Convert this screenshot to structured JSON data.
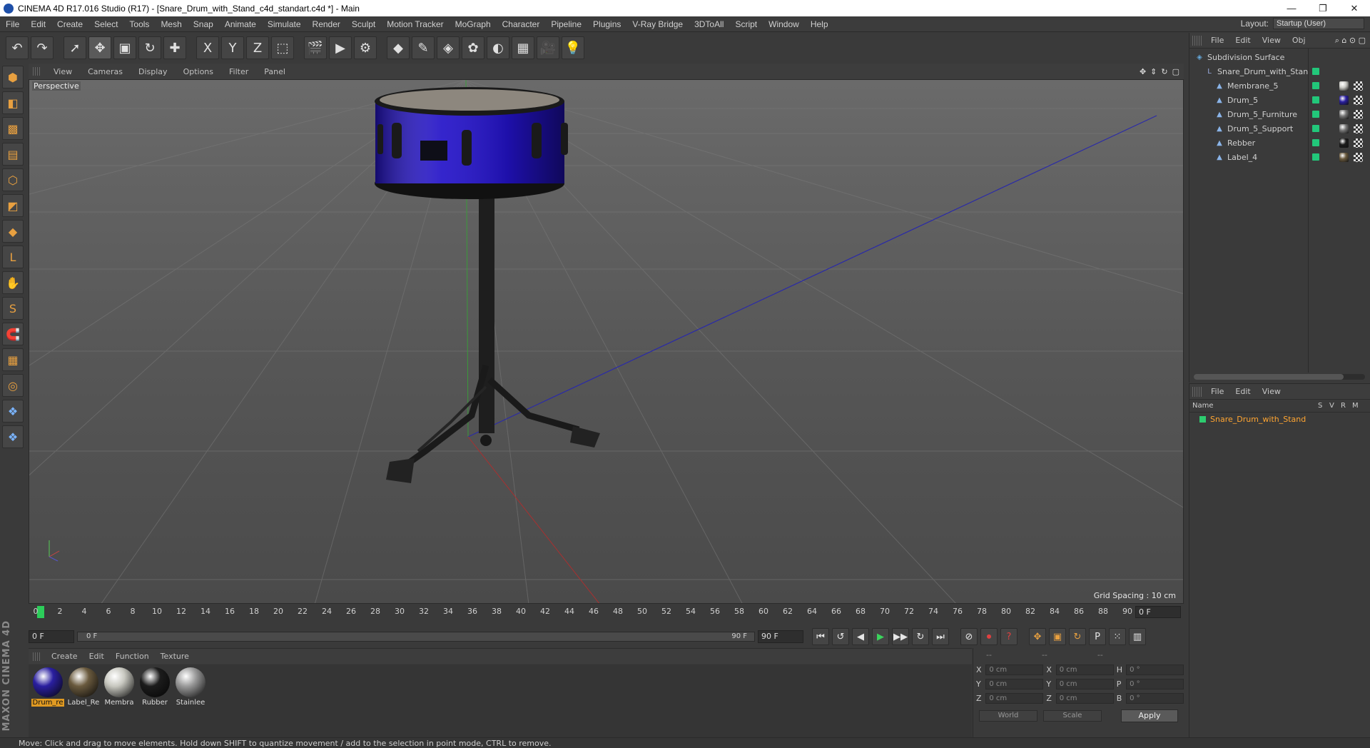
{
  "title_bar": {
    "title": "CINEMA 4D R17.016 Studio (R17) - [Snare_Drum_with_Stand_c4d_standart.c4d *] - Main",
    "minimize": "—",
    "restore": "❐",
    "close": "✕"
  },
  "menu": {
    "items": [
      "File",
      "Edit",
      "Create",
      "Select",
      "Tools",
      "Mesh",
      "Snap",
      "Animate",
      "Simulate",
      "Render",
      "Sculpt",
      "Motion Tracker",
      "MoGraph",
      "Character",
      "Pipeline",
      "Plugins",
      "V-Ray Bridge",
      "3DToAll",
      "Script",
      "Window",
      "Help"
    ],
    "layout_label": "Layout:",
    "layout_value": "Startup (User)"
  },
  "toolbar": {
    "icons": [
      "undo-icon",
      "redo-icon",
      "select-icon",
      "move-icon",
      "scale-icon",
      "rotate-icon",
      "transform-icon",
      "x-axis-icon",
      "y-axis-icon",
      "z-axis-icon",
      "coordinate-system-icon",
      "render-view-icon",
      "render-picture-viewer-icon",
      "render-settings-icon",
      "cube-icon",
      "pen-icon",
      "subdivision-icon",
      "mograph-cloner-icon",
      "deformer-icon",
      "floor-icon",
      "camera-icon",
      "light-icon"
    ],
    "glyphs": [
      "↶",
      "↷",
      "➚",
      "✥",
      "▣",
      "↻",
      "✚",
      "X",
      "Y",
      "Z",
      "⬚",
      "🎬",
      "▶",
      "⚙",
      "◆",
      "✎",
      "◈",
      "✿",
      "◐",
      "▦",
      "🎥",
      "💡"
    ]
  },
  "left_palette": {
    "icons": [
      "make-editable-icon",
      "model-mode-icon",
      "texture-mode-icon",
      "workplane-icon",
      "points-mode-icon",
      "edges-mode-icon",
      "polygons-mode-icon",
      "axis-mode-icon",
      "tweak-mode-icon",
      "solo-icon",
      "snap-icon",
      "grid-snap-icon",
      "workplane-snap-icon",
      "python-icon",
      "python-2-icon"
    ],
    "glyphs": [
      "⬢",
      "◧",
      "▩",
      "▤",
      "⬡",
      "◩",
      "◆",
      "L",
      "✋",
      "S",
      "🧲",
      "▦",
      "◎",
      "❖",
      "❖"
    ],
    "brand": "MAXON CINEMA 4D"
  },
  "viewport": {
    "menu": [
      "View",
      "Cameras",
      "Display",
      "Options",
      "Filter",
      "Panel"
    ],
    "label": "Perspective",
    "grid_spacing": "Grid Spacing : 10 cm",
    "nav_glyphs": [
      "✥",
      "⇕",
      "↻",
      "▢"
    ]
  },
  "timeline": {
    "ticks": [
      "0",
      "2",
      "4",
      "6",
      "8",
      "10",
      "12",
      "14",
      "16",
      "18",
      "20",
      "22",
      "24",
      "26",
      "28",
      "30",
      "32",
      "34",
      "36",
      "38",
      "40",
      "42",
      "44",
      "46",
      "48",
      "50",
      "52",
      "54",
      "56",
      "58",
      "60",
      "62",
      "64",
      "66",
      "68",
      "70",
      "72",
      "74",
      "76",
      "78",
      "80",
      "82",
      "84",
      "86",
      "88",
      "90"
    ],
    "current_frame": "0 F"
  },
  "transport": {
    "start_field": "0 F",
    "range_start": "0 F",
    "range_end": "90 F",
    "end_field": "90 F",
    "buttons": [
      "⏮",
      "↺",
      "◀",
      "▶",
      "▶▶",
      "↻",
      "⏭",
      "⊘",
      "⏺",
      "?",
      "✥",
      "▣",
      "↻",
      "P",
      "⁙",
      "▥"
    ],
    "button_names": [
      "go-to-start-icon",
      "previous-key-icon",
      "step-back-icon",
      "play-icon",
      "step-forward-icon",
      "next-key-icon",
      "go-to-end-icon",
      "record-disabled-icon",
      "record-icon",
      "auto-key-icon",
      "move-key-icon",
      "scale-key-icon",
      "rotate-key-icon",
      "param-key-icon",
      "pla-key-icon",
      "timeline-icon"
    ]
  },
  "materials": {
    "menu": [
      "Create",
      "Edit",
      "Function",
      "Texture"
    ],
    "items": [
      {
        "name": "Drum_re",
        "color": "#2a1fa0",
        "selected": true
      },
      {
        "name": "Label_Re",
        "color": "#6a5a3e",
        "selected": false
      },
      {
        "name": "Membra",
        "color": "#c8c8c0",
        "selected": false
      },
      {
        "name": "Rubber",
        "color": "#1c1c1c",
        "selected": false
      },
      {
        "name": "Stainlee",
        "color": "#9a9a9a",
        "selected": false
      }
    ]
  },
  "coordinates": {
    "header": [
      "--",
      "--",
      "--"
    ],
    "rows": [
      {
        "a": "X",
        "v1": "0 cm",
        "b": "X",
        "v2": "0 cm",
        "c": "H",
        "v3": "0 °"
      },
      {
        "a": "Y",
        "v1": "0 cm",
        "b": "Y",
        "v2": "0 cm",
        "c": "P",
        "v3": "0 °"
      },
      {
        "a": "Z",
        "v1": "0 cm",
        "b": "Z",
        "v2": "0 cm",
        "c": "B",
        "v3": "0 °"
      }
    ],
    "world": "World",
    "scale": "Scale",
    "apply": "Apply"
  },
  "object_manager": {
    "menu": [
      "File",
      "Edit",
      "View",
      "Obj"
    ],
    "objects": [
      {
        "name": "Subdivision Surface",
        "indent": 0,
        "icon": "subdivision-surface-icon",
        "glyph": "◈"
      },
      {
        "name": "Snare_Drum_with_Stan",
        "indent": 1,
        "icon": "null-object-icon",
        "glyph": "L"
      },
      {
        "name": "Membrane_5",
        "indent": 2,
        "icon": "polygon-object-icon",
        "glyph": "▲",
        "tag": "#c9c9c4"
      },
      {
        "name": "Drum_5",
        "indent": 2,
        "icon": "polygon-object-icon",
        "glyph": "▲",
        "tag": "#2a1fa0"
      },
      {
        "name": "Drum_5_Furniture",
        "indent": 2,
        "icon": "polygon-object-icon",
        "glyph": "▲",
        "tag": "#777777"
      },
      {
        "name": "Drum_5_Support",
        "indent": 2,
        "icon": "polygon-object-icon",
        "glyph": "▲",
        "tag": "#777777"
      },
      {
        "name": "Rebber",
        "indent": 2,
        "icon": "polygon-object-icon",
        "glyph": "▲",
        "tag": "#1c1c1c"
      },
      {
        "name": "Label_4",
        "indent": 2,
        "icon": "polygon-object-icon",
        "glyph": "▲",
        "tag": "#6a5a3e"
      }
    ]
  },
  "layer_manager": {
    "menu": [
      "File",
      "Edit",
      "View"
    ],
    "columns": [
      "Name",
      "S",
      "V",
      "R",
      "M"
    ],
    "layers": [
      {
        "name": "Snare_Drum_with_Stand"
      }
    ]
  },
  "status": {
    "text": "Move: Click and drag to move elements. Hold down SHIFT to quantize movement / add to the selection in point mode, CTRL to remove."
  },
  "colors": {
    "accent_orange": "#ffa531",
    "enable_green": "#22c77a",
    "drum_blue": "#2a1fa0",
    "playhead_green": "#2ccd5a"
  }
}
